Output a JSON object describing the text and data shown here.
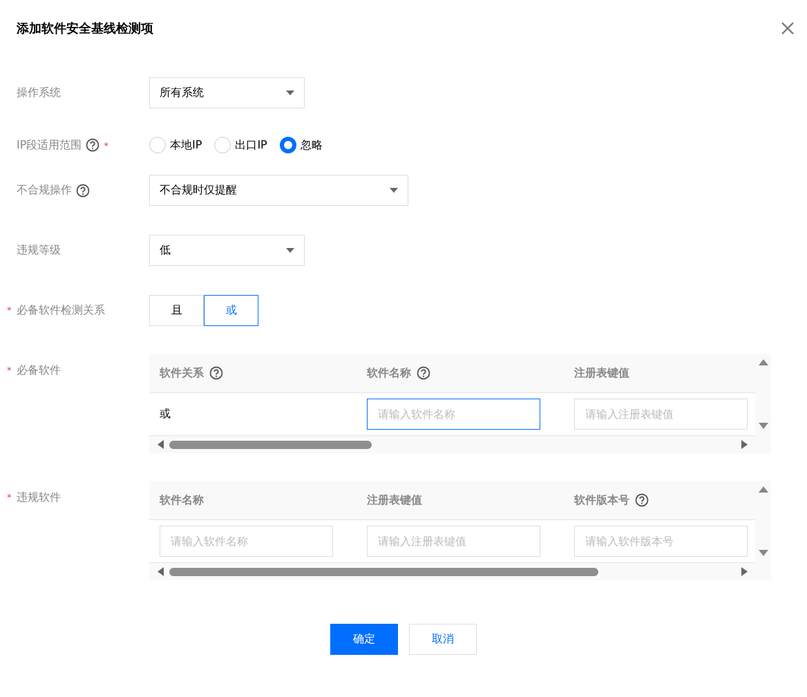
{
  "dialog": {
    "title": "添加软件安全基线检测项"
  },
  "fields": [
    {
      "kind": "select",
      "label": "操作系统",
      "help": false,
      "value": "所有系统"
    },
    {
      "kind": "radio",
      "label": "IP段适用范围",
      "required_mark": "*",
      "help": true,
      "options": [
        {
          "label": "本地IP",
          "selected": false
        },
        {
          "label": "出口IP",
          "selected": false
        },
        {
          "label": "忽略",
          "selected": true
        }
      ]
    },
    {
      "kind": "select",
      "label": "不合规操作",
      "help": true,
      "value": "不合规时仅提醒"
    },
    {
      "kind": "select",
      "label": "违规等级",
      "help": false,
      "value": "低"
    },
    {
      "kind": "segmented",
      "label": "必备软件检测关系",
      "required_mark": "*",
      "help": false,
      "options": [
        {
          "label": "且",
          "selected": false
        },
        {
          "label": "或",
          "selected": true
        }
      ]
    },
    {
      "kind": "table",
      "label": "必备软件",
      "required_mark": "*",
      "help": false,
      "columns": [
        {
          "label": "软件关系",
          "help": true
        },
        {
          "label": "软件名称",
          "help": true
        },
        {
          "label": "注册表键值",
          "help": false
        }
      ],
      "rows": [
        {
          "cells": [
            {
              "kind": "text",
              "value": "或"
            },
            {
              "kind": "input",
              "placeholder": "请输入软件名称",
              "focused": true
            },
            {
              "kind": "input",
              "placeholder": "请输入注册表键值",
              "focused": false
            }
          ]
        }
      ]
    },
    {
      "kind": "table",
      "label": "违规软件",
      "required_mark": "*",
      "help": false,
      "columns": [
        {
          "label": "软件名称",
          "help": false
        },
        {
          "label": "注册表键值",
          "help": false
        },
        {
          "label": "软件版本号",
          "help": true
        }
      ],
      "rows": [
        {
          "cells": [
            {
              "kind": "input",
              "placeholder": "请输入软件名称",
              "focused": false
            },
            {
              "kind": "input",
              "placeholder": "请输入注册表键值",
              "focused": false
            },
            {
              "kind": "input",
              "placeholder": "请输入软件版本号",
              "focused": false
            }
          ]
        }
      ]
    }
  ],
  "buttons": [
    {
      "label": "确定",
      "primary": true
    },
    {
      "label": "取消",
      "primary": false
    }
  ]
}
